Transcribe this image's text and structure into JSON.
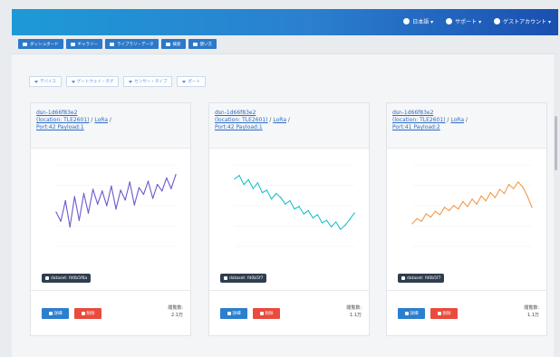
{
  "topbar": {
    "menus": [
      {
        "label": "日本語 ▾",
        "icon": "globe-icon"
      },
      {
        "label": "サポート ▾",
        "icon": "help-icon"
      },
      {
        "label": "ゲストアカウント ▾",
        "icon": "user-icon"
      }
    ]
  },
  "nav": {
    "items": [
      {
        "label": "ダッシュボード",
        "icon": "dashboard-icon"
      },
      {
        "label": "ギャラリー",
        "icon": "gallery-icon"
      },
      {
        "label": "ライブラリ・データ",
        "icon": "library-icon"
      },
      {
        "label": "検索",
        "icon": "search-icon"
      },
      {
        "label": "使い方",
        "icon": "info-icon"
      }
    ]
  },
  "filters": {
    "items": [
      {
        "label": "デバイス"
      },
      {
        "label": "ゲートウェイ・タグ"
      },
      {
        "label": "センサー・タイプ"
      },
      {
        "label": "ポート"
      }
    ]
  },
  "cards": [
    {
      "title_id": "dsn-1d66f83e2",
      "title_loc": "(location: TLE2601)",
      "title_tech": "LoRa",
      "title_port": "Port:42 Payload:1",
      "dataset_badge": "dataset: fd0b5f6a",
      "btn_a": "詳細",
      "btn_b": "削除",
      "views_label": "閲覧数:",
      "views_value": "2.1万",
      "chart_data": {
        "type": "line",
        "color": "#6a5acd",
        "ylim": [
          0,
          10
        ],
        "values": [
          4.2,
          3.1,
          5.6,
          2.4,
          6.1,
          3.2,
          6.5,
          4.1,
          7.0,
          5.2,
          6.8,
          5.0,
          7.4,
          4.6,
          6.9,
          5.7,
          7.9,
          5.1,
          7.2,
          6.4,
          8.0,
          5.9,
          7.6,
          6.8,
          8.4,
          7.1,
          8.8
        ]
      }
    },
    {
      "title_id": "dsn-1d66f83e2",
      "title_loc": "(location: TLE2601)",
      "title_tech": "LoRa",
      "title_port": "Port:42 Payload:1",
      "dataset_badge": "dataset: fd0b5f7",
      "btn_a": "詳細",
      "btn_b": "削除",
      "views_label": "閲覧数:",
      "views_value": "1.1万",
      "chart_data": {
        "type": "line",
        "color": "#1fc1c8",
        "ylim": [
          0,
          10
        ],
        "values": [
          8.3,
          8.7,
          7.6,
          8.2,
          7.1,
          7.8,
          6.6,
          6.9,
          5.8,
          6.5,
          6.0,
          5.2,
          5.6,
          4.6,
          4.9,
          4.0,
          4.4,
          3.5,
          3.9,
          2.9,
          3.2,
          2.4,
          3.0,
          2.1,
          2.6,
          3.3,
          4.1
        ]
      }
    },
    {
      "title_id": "dsn-1d66f83e2",
      "title_loc": "(location: TLE2601)",
      "title_tech": "LoRa",
      "title_port": "Port:41 Payload:2",
      "dataset_badge": "dataset: fd0b5f7",
      "btn_a": "詳細",
      "btn_b": "削除",
      "views_label": "閲覧数:",
      "views_value": "1.1万",
      "chart_data": {
        "type": "line",
        "color": "#f39a4a",
        "ylim": [
          0,
          10
        ],
        "values": [
          2.8,
          3.4,
          3.1,
          4.0,
          3.6,
          4.3,
          3.9,
          4.8,
          4.4,
          5.0,
          4.6,
          5.5,
          4.9,
          5.8,
          5.2,
          6.2,
          5.6,
          6.6,
          6.0,
          7.0,
          6.5,
          7.6,
          7.1,
          7.9,
          7.3,
          6.2,
          4.8
        ]
      }
    }
  ]
}
